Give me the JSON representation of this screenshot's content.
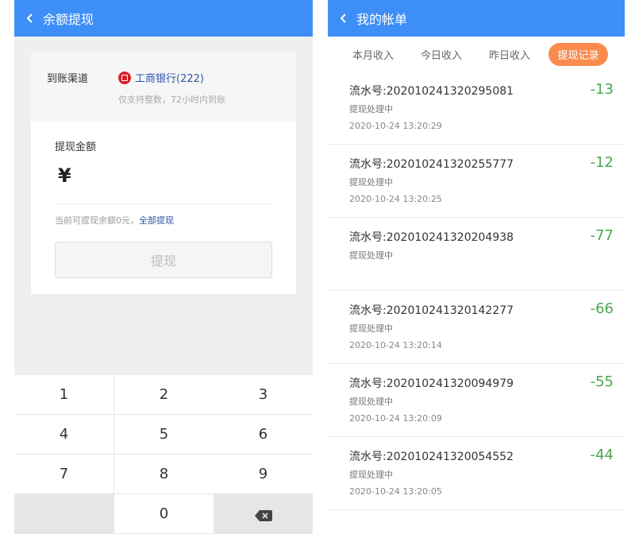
{
  "left": {
    "title": "余额提现",
    "channel_label": "到账渠道",
    "bank_name": "工商银行(222)",
    "bank_note": "仅支持整数，72小时内到账",
    "amount_label": "提现金额",
    "currency": "¥",
    "available_text": "当前可提现余额0元，",
    "withdraw_all": "全部提现",
    "submit_label": "提现",
    "keys": [
      "1",
      "2",
      "3",
      "4",
      "5",
      "6",
      "7",
      "8",
      "9",
      "",
      "0",
      "delete-icon"
    ]
  },
  "right": {
    "title": "我的帐单",
    "tabs": [
      "本月收入",
      "今日收入",
      "昨日收入",
      "提现记录"
    ],
    "active_tab": "提现记录",
    "records": [
      {
        "serial": "流水号:202010241320295081",
        "status": "提现处理中",
        "time": "2020-10-24 13:20:29",
        "amount": "-13"
      },
      {
        "serial": "流水号:202010241320255777",
        "status": "提现处理中",
        "time": "2020-10-24 13:20:25",
        "amount": "-12"
      },
      {
        "serial": "流水号:202010241320204938",
        "status": "提现处理中",
        "time": "",
        "amount": "-77"
      },
      {
        "serial": "流水号:202010241320142277",
        "status": "提现处理中",
        "time": "2020-10-24 13:20:14",
        "amount": "-66"
      },
      {
        "serial": "流水号:202010241320094979",
        "status": "提现处理中",
        "time": "2020-10-24 13:20:09",
        "amount": "-55"
      },
      {
        "serial": "流水号:202010241320054552",
        "status": "提现处理中",
        "time": "2020-10-24 13:20:05",
        "amount": "-44"
      }
    ]
  },
  "colors": {
    "header": "#3e8ef7",
    "active_tab": "#f98b4e",
    "amount": "#4aa84a",
    "bank_icon": "#d6202a",
    "link": "#2c56a6"
  }
}
